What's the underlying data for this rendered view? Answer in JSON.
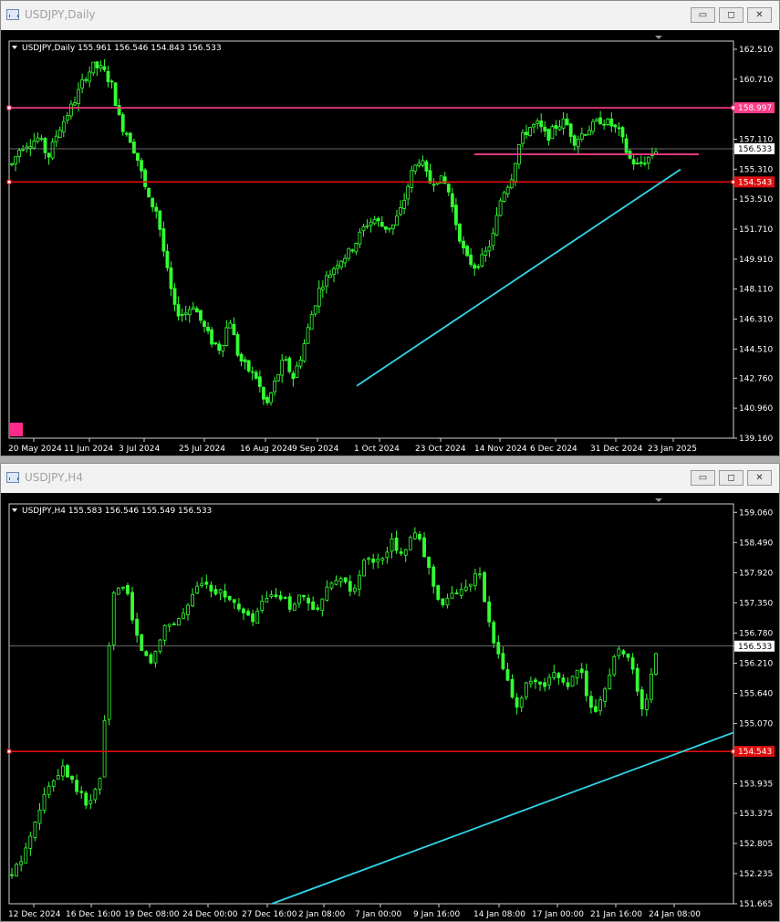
{
  "windows": [
    {
      "title": "USDJPY,Daily",
      "info": "USDJPY,Daily  155.961 156.546 154.843 156.533",
      "controls": {
        "minimize": "▭",
        "maximize": "◻",
        "close": "✕"
      },
      "chart_data": {
        "type": "candlestick",
        "symbol": "USDJPY",
        "timeframe": "Daily",
        "ohlc_last": {
          "open": 155.961,
          "high": 156.546,
          "low": 154.843,
          "close": 156.533
        },
        "ylim": [
          139.16,
          163.0
        ],
        "y_ticks": [
          "162.510",
          "160.710",
          "158.997",
          "157.110",
          "156.533",
          "155.310",
          "154.543",
          "153.510",
          "151.710",
          "149.910",
          "148.110",
          "146.310",
          "144.510",
          "142.760",
          "140.960",
          "139.160"
        ],
        "x_ticks": [
          "20 May 2024",
          "11 Jun 2024",
          "3 Jul 2024",
          "25 Jul 2024",
          "16 Aug 2024",
          "9 Sep 2024",
          "1 Oct 2024",
          "23 Oct 2024",
          "14 Nov 2024",
          "6 Dec 2024",
          "31 Dec 2024",
          "23 Jan 2025"
        ],
        "anchor_prices": [
          155.6,
          156.7,
          156.9,
          157.2,
          156.0,
          157.5,
          158.5,
          159.5,
          160.8,
          161.5,
          161.3,
          160.4,
          158.0,
          157.2,
          155.7,
          153.5,
          152.8,
          149.5,
          146.8,
          146.6,
          147.2,
          146.0,
          145.0,
          144.5,
          146.4,
          144.0,
          143.3,
          142.8,
          141.0,
          142.5,
          143.9,
          142.8,
          144.3,
          146.5,
          148.3,
          149.0,
          149.8,
          150.2,
          151.0,
          152.0,
          152.3,
          151.8,
          151.9,
          153.0,
          155.0,
          156.0,
          154.5,
          154.8,
          154.3,
          152.0,
          150.0,
          149.5,
          150.0,
          151.2,
          153.8,
          154.7,
          157.0,
          157.8,
          158.0,
          157.2,
          157.9,
          158.2,
          157.0,
          157.5,
          157.9,
          158.3,
          158.0,
          157.5,
          156.0,
          155.5,
          155.9,
          156.5
        ],
        "lines": [
          {
            "kind": "horizontal",
            "price": 158.997,
            "color": "#ff3b86",
            "label": "158.997"
          },
          {
            "kind": "current",
            "price": 156.533,
            "color": "#8c8c8c",
            "label": "156.533"
          },
          {
            "kind": "horizontal",
            "price": 154.543,
            "color": "#e01010",
            "label": "154.543"
          },
          {
            "kind": "segment",
            "color": "#ff3b86",
            "from": [
              "14 Nov 2024",
              156.2
            ],
            "to": [
              "27 Jan 2025",
              156.2
            ]
          },
          {
            "kind": "trend",
            "color": "#30d5e8",
            "from": [
              "1 Oct 2024",
              142.3
            ],
            "to": [
              "27 Jan 2025",
              155.3
            ]
          }
        ]
      },
      "colors": {
        "background": "#000000",
        "candle": "#33ff33",
        "axis_text": "#ffffff"
      }
    },
    {
      "title": "USDJPY,H4",
      "info": "USDJPY,H4  155.583 156.546 155.549 156.533",
      "controls": {
        "minimize": "▭",
        "maximize": "◻",
        "close": "✕"
      },
      "chart_data": {
        "type": "candlestick",
        "symbol": "USDJPY",
        "timeframe": "H4",
        "ohlc_last": {
          "open": 155.583,
          "high": 156.546,
          "low": 155.549,
          "close": 156.533
        },
        "ylim": [
          151.665,
          159.22
        ],
        "y_ticks": [
          "159.060",
          "158.490",
          "157.920",
          "157.350",
          "156.780",
          "156.533",
          "156.210",
          "155.640",
          "155.070",
          "154.543",
          "153.935",
          "153.375",
          "152.805",
          "152.235",
          "151.665"
        ],
        "x_ticks": [
          "12 Dec 2024",
          "16 Dec 16:00",
          "19 Dec 08:00",
          "24 Dec 00:00",
          "27 Dec 16:00",
          "2 Jan 08:00",
          "7 Jan 00:00",
          "9 Jan 16:00",
          "14 Jan 08:00",
          "17 Jan 00:00",
          "21 Jan 16:00",
          "24 Jan 08:00"
        ],
        "anchor_prices": [
          152.2,
          152.6,
          153.4,
          153.9,
          154.3,
          153.9,
          153.5,
          154.0,
          157.5,
          157.7,
          156.6,
          156.2,
          156.9,
          157.0,
          157.3,
          157.8,
          157.6,
          157.5,
          157.2,
          157.0,
          157.4,
          157.5,
          157.3,
          157.5,
          157.1,
          157.6,
          157.8,
          157.5,
          158.2,
          158.1,
          158.5,
          158.3,
          158.7,
          158.0,
          157.3,
          157.5,
          157.7,
          157.9,
          156.7,
          156.0,
          155.4,
          155.9,
          155.7,
          156.0,
          155.8,
          156.1,
          155.2,
          155.8,
          156.5,
          156.3,
          155.2,
          156.4
        ],
        "lines": [
          {
            "kind": "current",
            "price": 156.533,
            "color": "#8c8c8c",
            "label": "156.533"
          },
          {
            "kind": "horizontal",
            "price": 154.543,
            "color": "#e01010",
            "label": "154.543"
          },
          {
            "kind": "trend",
            "color": "#30d5e8",
            "from": [
              "27 Dec 16:00",
              151.665
            ],
            "to": [
              "24 Jan 16:00",
              154.9
            ]
          }
        ]
      },
      "colors": {
        "background": "#000000",
        "candle": "#33ff33",
        "axis_text": "#ffffff"
      }
    }
  ]
}
